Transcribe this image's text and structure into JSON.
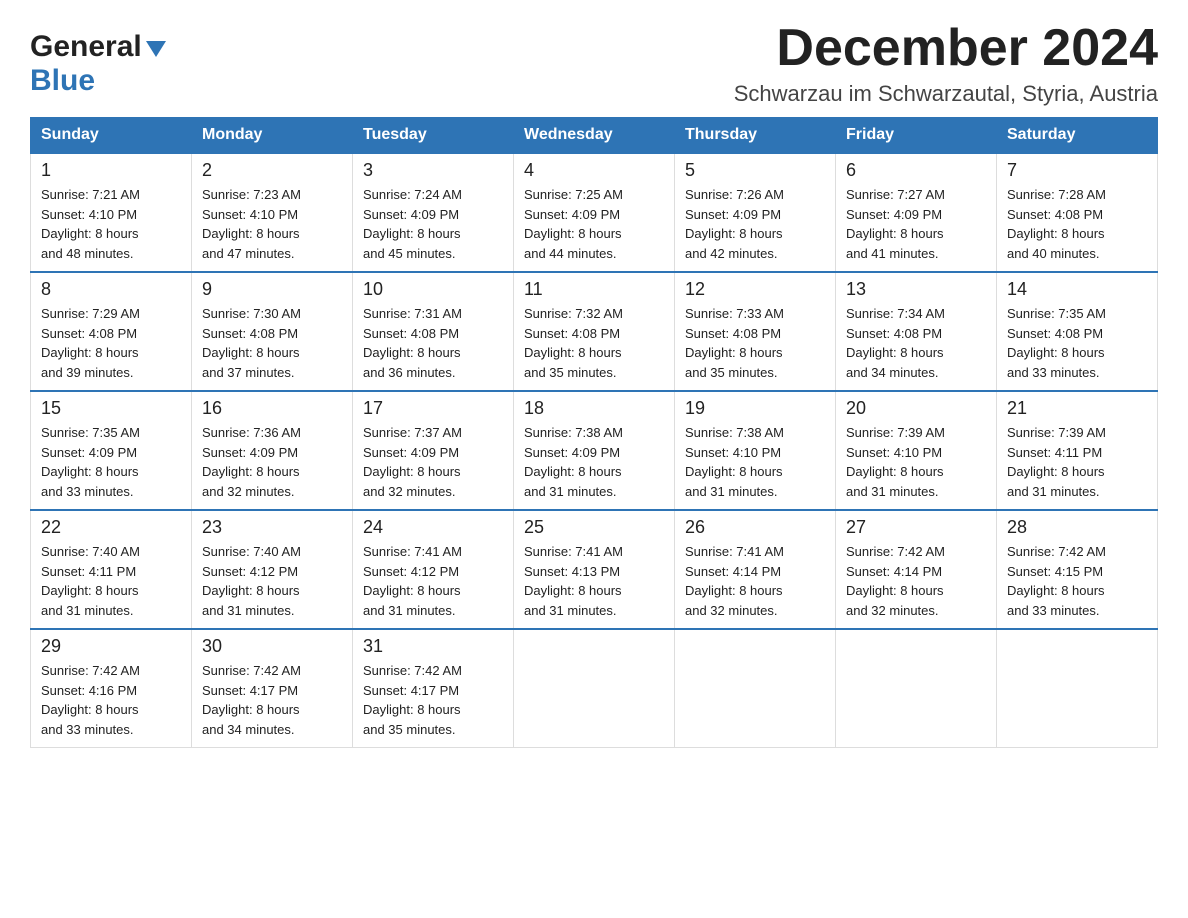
{
  "header": {
    "logo_general": "General",
    "logo_blue": "Blue",
    "month_title": "December 2024",
    "location": "Schwarzau im Schwarzautal, Styria, Austria"
  },
  "days_of_week": [
    "Sunday",
    "Monday",
    "Tuesday",
    "Wednesday",
    "Thursday",
    "Friday",
    "Saturday"
  ],
  "weeks": [
    [
      {
        "day": "1",
        "sunrise": "7:21 AM",
        "sunset": "4:10 PM",
        "daylight": "8 hours and 48 minutes."
      },
      {
        "day": "2",
        "sunrise": "7:23 AM",
        "sunset": "4:10 PM",
        "daylight": "8 hours and 47 minutes."
      },
      {
        "day": "3",
        "sunrise": "7:24 AM",
        "sunset": "4:09 PM",
        "daylight": "8 hours and 45 minutes."
      },
      {
        "day": "4",
        "sunrise": "7:25 AM",
        "sunset": "4:09 PM",
        "daylight": "8 hours and 44 minutes."
      },
      {
        "day": "5",
        "sunrise": "7:26 AM",
        "sunset": "4:09 PM",
        "daylight": "8 hours and 42 minutes."
      },
      {
        "day": "6",
        "sunrise": "7:27 AM",
        "sunset": "4:09 PM",
        "daylight": "8 hours and 41 minutes."
      },
      {
        "day": "7",
        "sunrise": "7:28 AM",
        "sunset": "4:08 PM",
        "daylight": "8 hours and 40 minutes."
      }
    ],
    [
      {
        "day": "8",
        "sunrise": "7:29 AM",
        "sunset": "4:08 PM",
        "daylight": "8 hours and 39 minutes."
      },
      {
        "day": "9",
        "sunrise": "7:30 AM",
        "sunset": "4:08 PM",
        "daylight": "8 hours and 37 minutes."
      },
      {
        "day": "10",
        "sunrise": "7:31 AM",
        "sunset": "4:08 PM",
        "daylight": "8 hours and 36 minutes."
      },
      {
        "day": "11",
        "sunrise": "7:32 AM",
        "sunset": "4:08 PM",
        "daylight": "8 hours and 35 minutes."
      },
      {
        "day": "12",
        "sunrise": "7:33 AM",
        "sunset": "4:08 PM",
        "daylight": "8 hours and 35 minutes."
      },
      {
        "day": "13",
        "sunrise": "7:34 AM",
        "sunset": "4:08 PM",
        "daylight": "8 hours and 34 minutes."
      },
      {
        "day": "14",
        "sunrise": "7:35 AM",
        "sunset": "4:08 PM",
        "daylight": "8 hours and 33 minutes."
      }
    ],
    [
      {
        "day": "15",
        "sunrise": "7:35 AM",
        "sunset": "4:09 PM",
        "daylight": "8 hours and 33 minutes."
      },
      {
        "day": "16",
        "sunrise": "7:36 AM",
        "sunset": "4:09 PM",
        "daylight": "8 hours and 32 minutes."
      },
      {
        "day": "17",
        "sunrise": "7:37 AM",
        "sunset": "4:09 PM",
        "daylight": "8 hours and 32 minutes."
      },
      {
        "day": "18",
        "sunrise": "7:38 AM",
        "sunset": "4:09 PM",
        "daylight": "8 hours and 31 minutes."
      },
      {
        "day": "19",
        "sunrise": "7:38 AM",
        "sunset": "4:10 PM",
        "daylight": "8 hours and 31 minutes."
      },
      {
        "day": "20",
        "sunrise": "7:39 AM",
        "sunset": "4:10 PM",
        "daylight": "8 hours and 31 minutes."
      },
      {
        "day": "21",
        "sunrise": "7:39 AM",
        "sunset": "4:11 PM",
        "daylight": "8 hours and 31 minutes."
      }
    ],
    [
      {
        "day": "22",
        "sunrise": "7:40 AM",
        "sunset": "4:11 PM",
        "daylight": "8 hours and 31 minutes."
      },
      {
        "day": "23",
        "sunrise": "7:40 AM",
        "sunset": "4:12 PM",
        "daylight": "8 hours and 31 minutes."
      },
      {
        "day": "24",
        "sunrise": "7:41 AM",
        "sunset": "4:12 PM",
        "daylight": "8 hours and 31 minutes."
      },
      {
        "day": "25",
        "sunrise": "7:41 AM",
        "sunset": "4:13 PM",
        "daylight": "8 hours and 31 minutes."
      },
      {
        "day": "26",
        "sunrise": "7:41 AM",
        "sunset": "4:14 PM",
        "daylight": "8 hours and 32 minutes."
      },
      {
        "day": "27",
        "sunrise": "7:42 AM",
        "sunset": "4:14 PM",
        "daylight": "8 hours and 32 minutes."
      },
      {
        "day": "28",
        "sunrise": "7:42 AM",
        "sunset": "4:15 PM",
        "daylight": "8 hours and 33 minutes."
      }
    ],
    [
      {
        "day": "29",
        "sunrise": "7:42 AM",
        "sunset": "4:16 PM",
        "daylight": "8 hours and 33 minutes."
      },
      {
        "day": "30",
        "sunrise": "7:42 AM",
        "sunset": "4:17 PM",
        "daylight": "8 hours and 34 minutes."
      },
      {
        "day": "31",
        "sunrise": "7:42 AM",
        "sunset": "4:17 PM",
        "daylight": "8 hours and 35 minutes."
      },
      null,
      null,
      null,
      null
    ]
  ],
  "labels": {
    "sunrise": "Sunrise:",
    "sunset": "Sunset:",
    "daylight": "Daylight:"
  }
}
